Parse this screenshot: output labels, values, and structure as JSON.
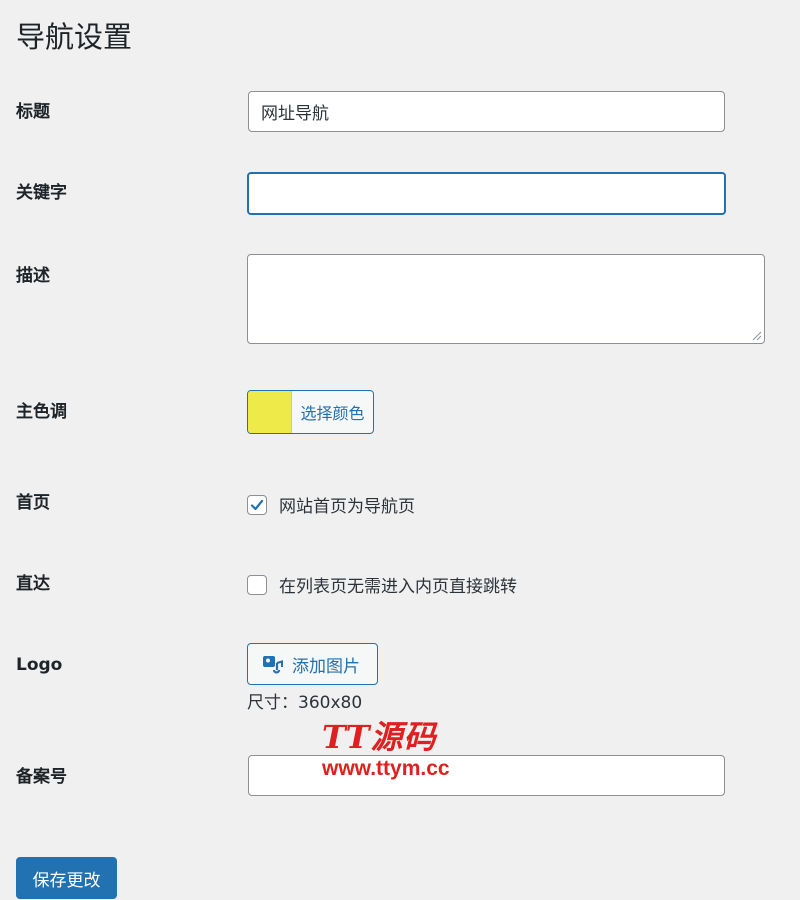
{
  "page": {
    "title": "导航设置"
  },
  "fields": {
    "title": {
      "label": "标题",
      "value": "网址导航"
    },
    "keywords": {
      "label": "关键字",
      "value": ""
    },
    "description": {
      "label": "描述",
      "value": ""
    },
    "theme_color": {
      "label": "主色调",
      "button_label": "选择颜色",
      "color": "#eeea4a"
    },
    "home": {
      "label": "首页",
      "checkbox_label": "网站首页为导航页",
      "checked": true
    },
    "direct": {
      "label": "直达",
      "checkbox_label": "在列表页无需进入内页直接跳转",
      "checked": false
    },
    "logo": {
      "label": "Logo",
      "button_label": "添加图片",
      "icon": "add-image-icon",
      "size_note": "尺寸：360x80"
    },
    "icp": {
      "label": "备案号",
      "value": ""
    }
  },
  "watermark": {
    "brand": "TT源码",
    "url": "www.ttym.cc"
  },
  "actions": {
    "save_label": "保存更改"
  },
  "colors": {
    "accent": "#2271b1",
    "background": "#f0f0f1",
    "watermark": "#e02020"
  }
}
